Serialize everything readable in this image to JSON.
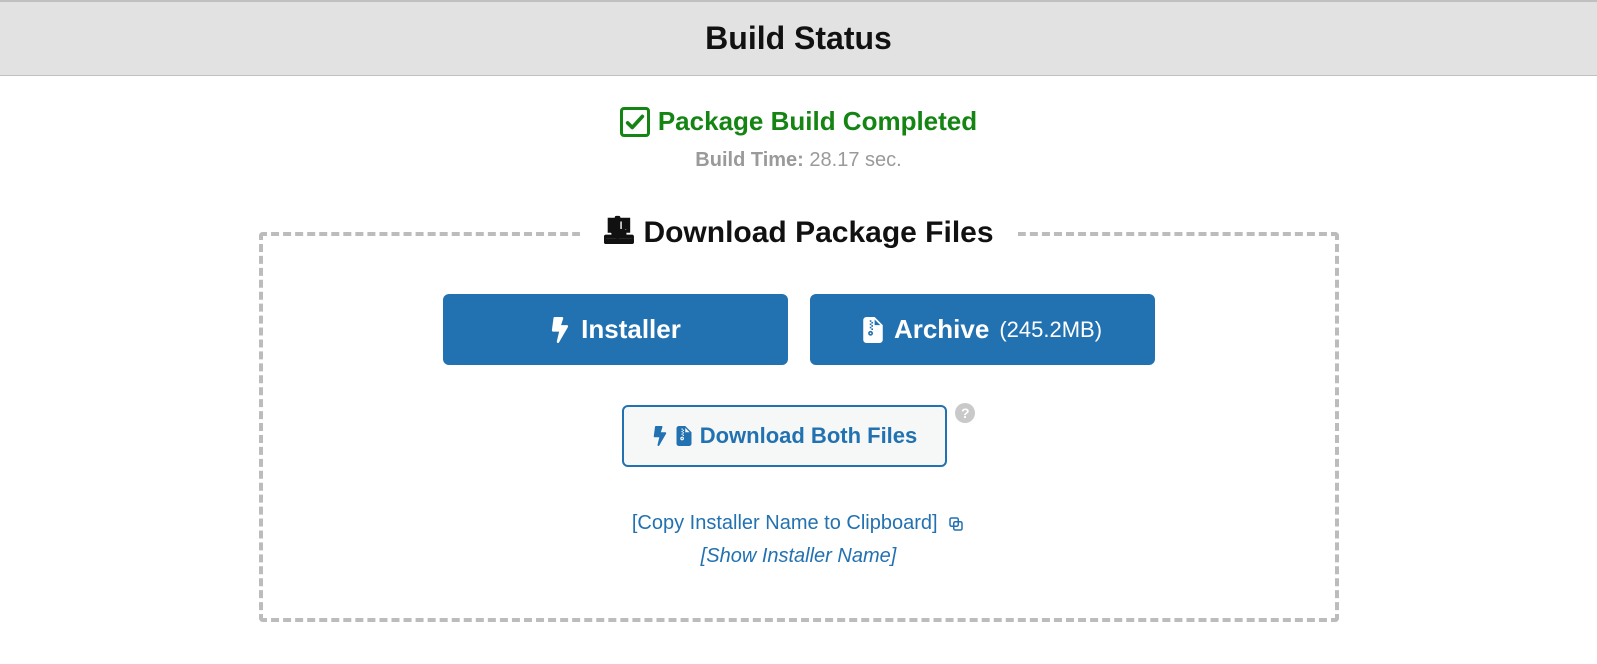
{
  "header": {
    "title": "Build Status"
  },
  "status": {
    "message": "Package Build Completed",
    "build_time_label": "Build Time:",
    "build_time_value": "28.17 sec."
  },
  "download": {
    "panel_title": "Download Package Files",
    "installer_label": "Installer",
    "archive_label": "Archive",
    "archive_size": "(245.2MB)",
    "both_label": "Download Both Files",
    "help_tooltip": "?",
    "copy_link": "[Copy Installer Name to Clipboard]",
    "show_link": "[Show Installer Name]"
  }
}
